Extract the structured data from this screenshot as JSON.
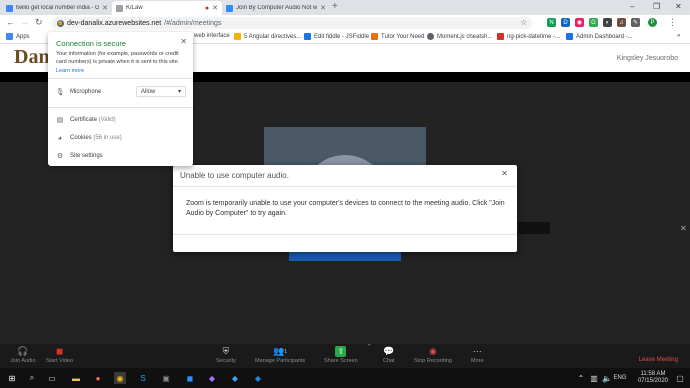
{
  "browser": {
    "tabs": [
      {
        "title": "twilio get local number india - G",
        "favicon_color": "#4285f4"
      },
      {
        "title": "K/Law",
        "favicon_color": "#9aa0a6"
      },
      {
        "title": "Join By Computer Audio Not wo",
        "favicon_color": "#2d8cff"
      }
    ],
    "window_controls": [
      "–",
      "❐",
      "✕"
    ],
    "url_host": "dev-danalix.azurewebsites.net",
    "url_path": "/#/admin/meetings",
    "extensions": [
      {
        "label": "N",
        "color": "#0f9d58"
      },
      {
        "label": "D",
        "color": "#1565c0"
      },
      {
        "label": "◉",
        "color": "#e91e63"
      },
      {
        "label": "G",
        "color": "#34a853"
      },
      {
        "label": "◐",
        "color": "#424242"
      },
      {
        "label": "♫",
        "color": "#6d4c41"
      },
      {
        "label": "✎",
        "color": "#616161"
      },
      {
        "label": "P",
        "color": "#1e8e3e"
      }
    ],
    "bookmarks": [
      {
        "label": "Apps",
        "color": "#4285f4"
      },
      {
        "label": "web interface",
        "color": "#9aa0a6"
      },
      {
        "label": "5 Angular directives...",
        "color": "#f4b400"
      },
      {
        "label": "Edit fiddle - JSFiddle",
        "color": "#1a73e8"
      },
      {
        "label": "Tutor Your Need",
        "color": "#e8710a"
      },
      {
        "label": "Moment.js cheatsh...",
        "color": "#5f6368"
      },
      {
        "label": "ng-pick-datetime -...",
        "color": "#d93025"
      },
      {
        "label": "Admin Dashboard -...",
        "color": "#1a73e8"
      }
    ]
  },
  "site": {
    "logo": "Dan",
    "username": "Kingsley Jesuorobo"
  },
  "popup": {
    "title": "Connection is secure",
    "description": "Your information (for example, passwords or credit card numbers) is private when it is sent to this site.",
    "learn_more": "Learn more",
    "microphone_label": "Microphone",
    "microphone_value": "Allow",
    "certificate_label": "Certificate",
    "certificate_status": "(Valid)",
    "cookies_label": "Cookies",
    "cookies_status": "(56 in use)",
    "site_settings_label": "Site settings"
  },
  "modal": {
    "title": "Unable to use computer audio.",
    "body": "Zoom is temporarily unable to use your computer's devices to connect to the meeting audio. Click \"Join Audio by Computer\" to try again."
  },
  "zoom_controls": [
    {
      "label": "Join Audio",
      "icon": "🎧"
    },
    {
      "label": "Start Video",
      "icon": "◼"
    },
    {
      "label": "Security",
      "icon": "⛨"
    },
    {
      "label": "Manage Participants",
      "icon": "👥"
    },
    {
      "label": "Share Screen",
      "icon": "⇧"
    },
    {
      "label": "Chat",
      "icon": "💬"
    },
    {
      "label": "Stop Recording",
      "icon": "◉"
    },
    {
      "label": "More",
      "icon": "⋯"
    }
  ],
  "participants_count": "1",
  "leave_label": "Leave Meeting",
  "taskbar": {
    "time": "11:58 AM",
    "date": "07/15/2020"
  }
}
